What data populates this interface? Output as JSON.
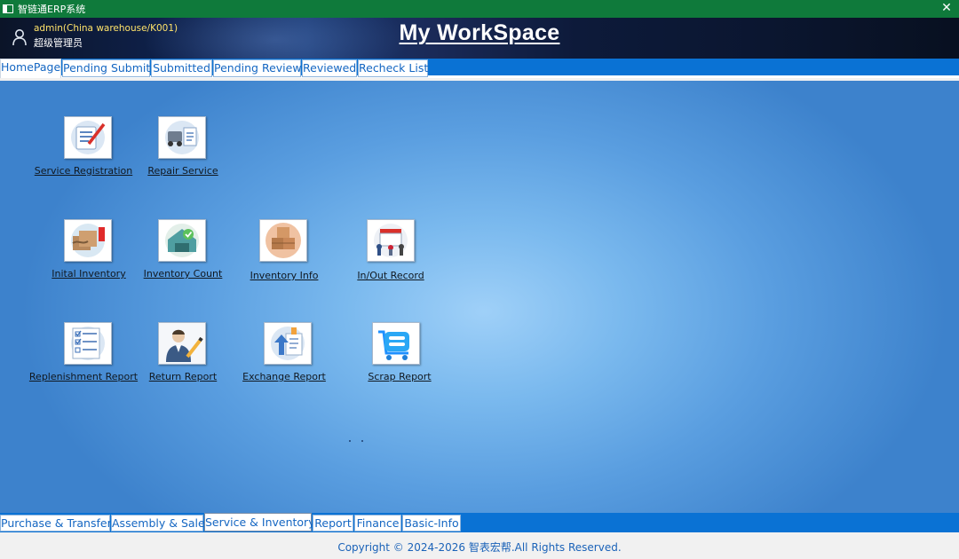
{
  "window": {
    "title": "智链通ERP系统",
    "close_glyph": "✕"
  },
  "header": {
    "user_account": "admin(China warehouse/K001)",
    "user_role": "超级管理员",
    "workspace_title": "My WorkSpace"
  },
  "top_tabs": [
    {
      "label": "HomePage",
      "active": true
    },
    {
      "label": "Pending Submit",
      "active": false
    },
    {
      "label": "Submitted",
      "active": false
    },
    {
      "label": "Pending Review",
      "active": false
    },
    {
      "label": "Reviewed",
      "active": false
    },
    {
      "label": "Recheck List",
      "active": false
    }
  ],
  "tiles": [
    {
      "label": "Service Registration",
      "icon": "service-registration-icon"
    },
    {
      "label": "Repair Service",
      "icon": "repair-service-icon"
    },
    {
      "label": "Inital Inventory",
      "icon": "initial-inventory-icon"
    },
    {
      "label": "Inventory Count",
      "icon": "inventory-count-icon"
    },
    {
      "label": "Inventory Info",
      "icon": "inventory-info-icon"
    },
    {
      "label": "In/Out Record",
      "icon": "in-out-record-icon"
    },
    {
      "label": "Replenishment Report",
      "icon": "replenishment-report-icon"
    },
    {
      "label": "Return Report",
      "icon": "return-report-icon"
    },
    {
      "label": "Exchange Report",
      "icon": "exchange-report-icon"
    },
    {
      "label": "Scrap Report",
      "icon": "scrap-report-icon"
    }
  ],
  "bottom_tabs": [
    {
      "label": "Purchase & Transfer",
      "active": false
    },
    {
      "label": "Assembly & Sale",
      "active": false
    },
    {
      "label": "Service & Inventory",
      "active": true
    },
    {
      "label": "Report",
      "active": false
    },
    {
      "label": "Finance",
      "active": false
    },
    {
      "label": "Basic-Info",
      "active": false
    }
  ],
  "footer": {
    "copyright": "Copyright © 2024-2026 智表宏帮.All Rights Reserved."
  },
  "colors": {
    "titlebar": "#0f7a3b",
    "tab_bar": "#0a72d4",
    "tab_text": "#1466c2",
    "user_account_text": "#ffe36a",
    "footer_text": "#1a62b8"
  }
}
